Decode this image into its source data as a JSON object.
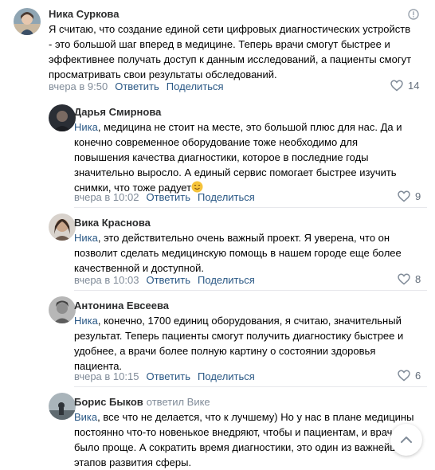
{
  "comments": [
    {
      "author": "Ника Суркова",
      "text": "Я считаю, что создание единой сети цифровых диагностических устройств\n- это большой шаг вперед в медицине. Теперь врачи смогут быстрее и\nэффективнее получать доступ к данным исследований, а пациенты смогут\nпросматривать свои результаты обследований.",
      "time": "вчера в 9:50",
      "reply_label": "Ответить",
      "share_label": "Поделиться",
      "likes": "14"
    },
    {
      "author": "Дарья Смирнова",
      "mention": "Ника",
      "text": ", медицина не стоит на месте, это большой плюс для нас. Да и\nконечно современное оборудование тоже необходимо для\nповышения качества диагностики, которое в последние годы\nзначительно выросло. А единый сервис помогает быстрее изучить\nснимки, что тоже радует",
      "time": "вчера в 10:02",
      "reply_label": "Ответить",
      "share_label": "Поделиться",
      "likes": "9"
    },
    {
      "author": "Вика Краснова",
      "mention": "Ника",
      "text": ", это действительно очень важный проект. Я уверена, что он\nпозволит сделать медицинскую помощь в нашем городе еще более\nкачественной и доступной.",
      "time": "вчера в 10:03",
      "reply_label": "Ответить",
      "share_label": "Поделиться",
      "likes": "8"
    },
    {
      "author": "Антонина Евсеева",
      "mention": "Ника",
      "text": ", конечно, 1700 единиц оборудования, я считаю, значительный\nрезультат. Теперь пациенты смогут получить диагностику быстрее и\nудобнее, а врачи более полную картину о состоянии здоровья\nпациента.",
      "time": "вчера в 10:15",
      "reply_label": "Ответить",
      "share_label": "Поделиться",
      "likes": "6"
    },
    {
      "author": "Борис Быков",
      "replied_to": "ответил Вике",
      "mention": "Вика",
      "text": ", все что не делается, что к лучшему) Но у нас в плане медицины\nпостоянно что-то новенькое внедряют, чтобы и пациентам, и врачам\nбыло проще. А сократить время диагностики, это один из важнейших\nэтапов развития сферы."
    }
  ],
  "colors": {
    "link": "#2a5885",
    "meta": "#818c99",
    "divider": "#e7e8ec"
  },
  "icons": {
    "like": "heart-icon",
    "report": "report-icon",
    "scroll_up": "chevron-up-icon"
  }
}
